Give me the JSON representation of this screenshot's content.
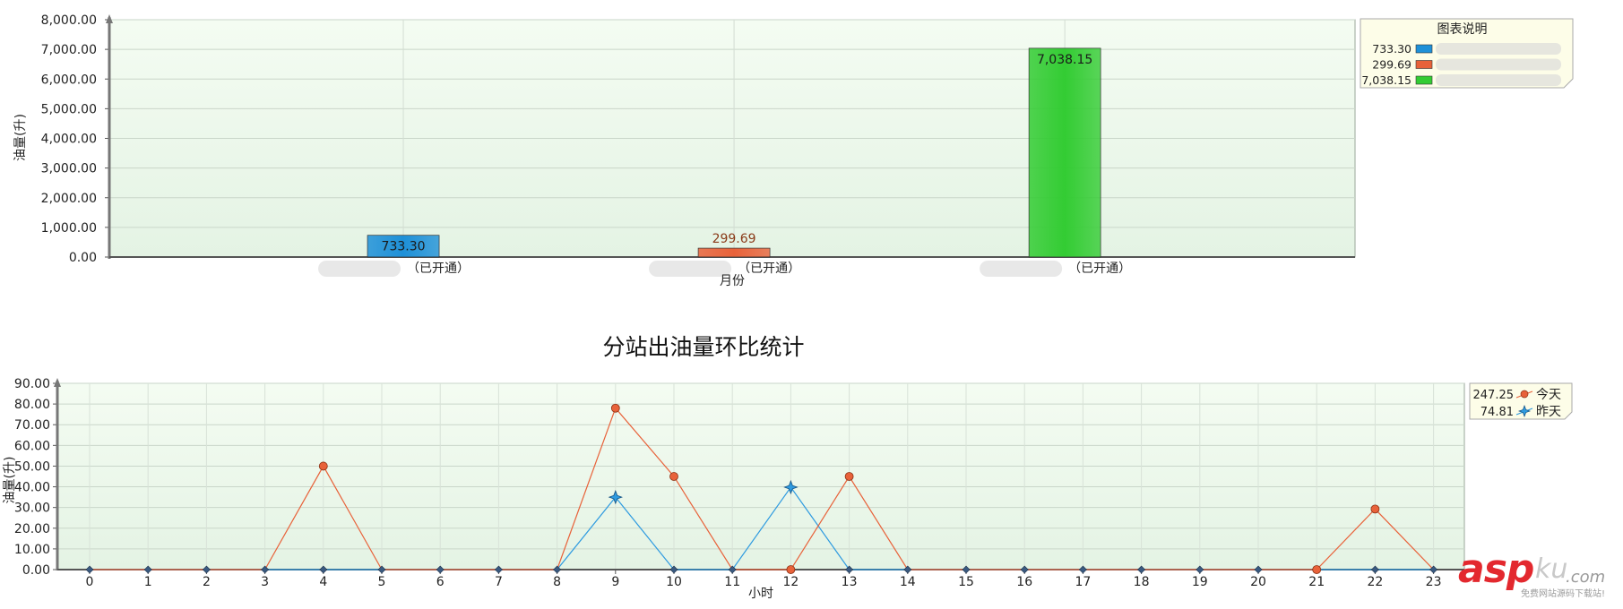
{
  "chart_data": [
    {
      "type": "bar",
      "ylabel": "油量(升)",
      "xlabel": "月份",
      "ylim": [
        0,
        8000
      ],
      "yticks": [
        "0.00",
        "1,000.00",
        "2,000.00",
        "3,000.00",
        "4,000.00",
        "5,000.00",
        "6,000.00",
        "7,000.00",
        "8,000.00"
      ],
      "categories": [
        "（已开通）",
        "（已开通）",
        "（已开通）"
      ],
      "values": [
        733.3,
        299.69,
        7038.15
      ],
      "value_labels": [
        "733.30",
        "299.69",
        "7,038.15"
      ],
      "colors": [
        "#1e90d8",
        "#e8623a",
        "#33cc33"
      ],
      "legend": {
        "title": "图表说明",
        "position": "top-right",
        "entries": [
          {
            "value": "733.30",
            "color": "#1e90d8"
          },
          {
            "value": "299.69",
            "color": "#e8623a"
          },
          {
            "value": "7,038.15",
            "color": "#33cc33"
          }
        ]
      },
      "grid": true
    },
    {
      "type": "line",
      "title": "分站出油量环比统计",
      "ylabel": "油量(升)",
      "xlabel": "小时",
      "ylim": [
        0,
        90
      ],
      "yticks": [
        "0.00",
        "10.00",
        "20.00",
        "30.00",
        "40.00",
        "50.00",
        "60.00",
        "70.00",
        "80.00",
        "90.00"
      ],
      "x": [
        0,
        1,
        2,
        3,
        4,
        5,
        6,
        7,
        8,
        9,
        10,
        11,
        12,
        13,
        14,
        15,
        16,
        17,
        18,
        19,
        20,
        21,
        22,
        23
      ],
      "series": [
        {
          "name": "今天",
          "total": "247.25",
          "color": "#e8623a",
          "marker": "circle",
          "values": [
            0,
            0,
            0,
            0,
            50,
            0,
            0,
            0,
            0,
            78,
            45,
            0,
            0,
            45,
            0,
            0,
            0,
            0,
            0,
            0,
            0,
            0,
            29.25,
            0
          ]
        },
        {
          "name": "昨天",
          "total": "74.81",
          "color": "#2f9be0",
          "marker": "star",
          "values": [
            0,
            0,
            0,
            0,
            0,
            0,
            0,
            0,
            0,
            35,
            0,
            0,
            39.81,
            0,
            0,
            0,
            0,
            0,
            0,
            0,
            0,
            0,
            0,
            0
          ]
        }
      ],
      "legend": {
        "position": "top-right"
      },
      "grid": true
    }
  ],
  "watermark": {
    "brand": "asp",
    "brand2": "ku",
    "suffix": ".com",
    "tagline": "免费网站源码下载站!"
  }
}
